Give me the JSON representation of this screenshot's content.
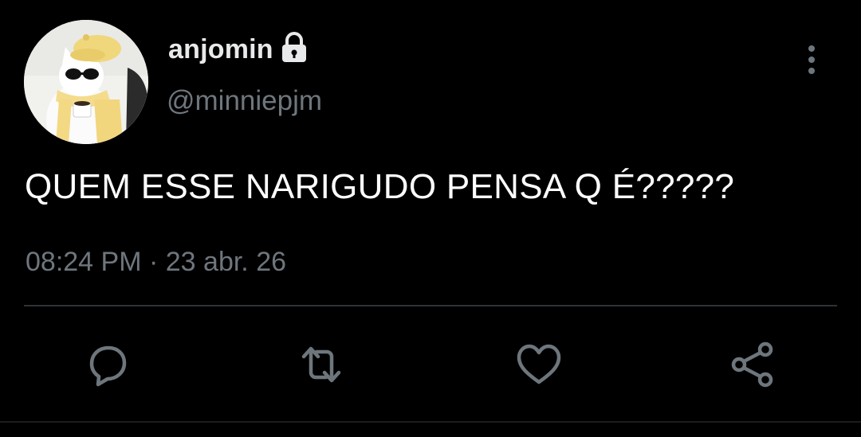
{
  "tweet": {
    "display_name": "anjomin",
    "handle": "@minniepjm",
    "text": "QUEM ESSE NARIGUDO PENSA Q É?????",
    "time": "08:24 PM",
    "separator": "·",
    "date": "23 abr. 26",
    "protected": true
  },
  "icons": {
    "lock": "lock-icon",
    "more": "more-vertical-icon",
    "reply": "reply-icon",
    "retweet": "retweet-icon",
    "like": "heart-icon",
    "share": "share-icon"
  },
  "colors": {
    "background": "#000000",
    "text": "#ffffff",
    "secondary": "#6e767d",
    "divider": "#2f3336"
  }
}
